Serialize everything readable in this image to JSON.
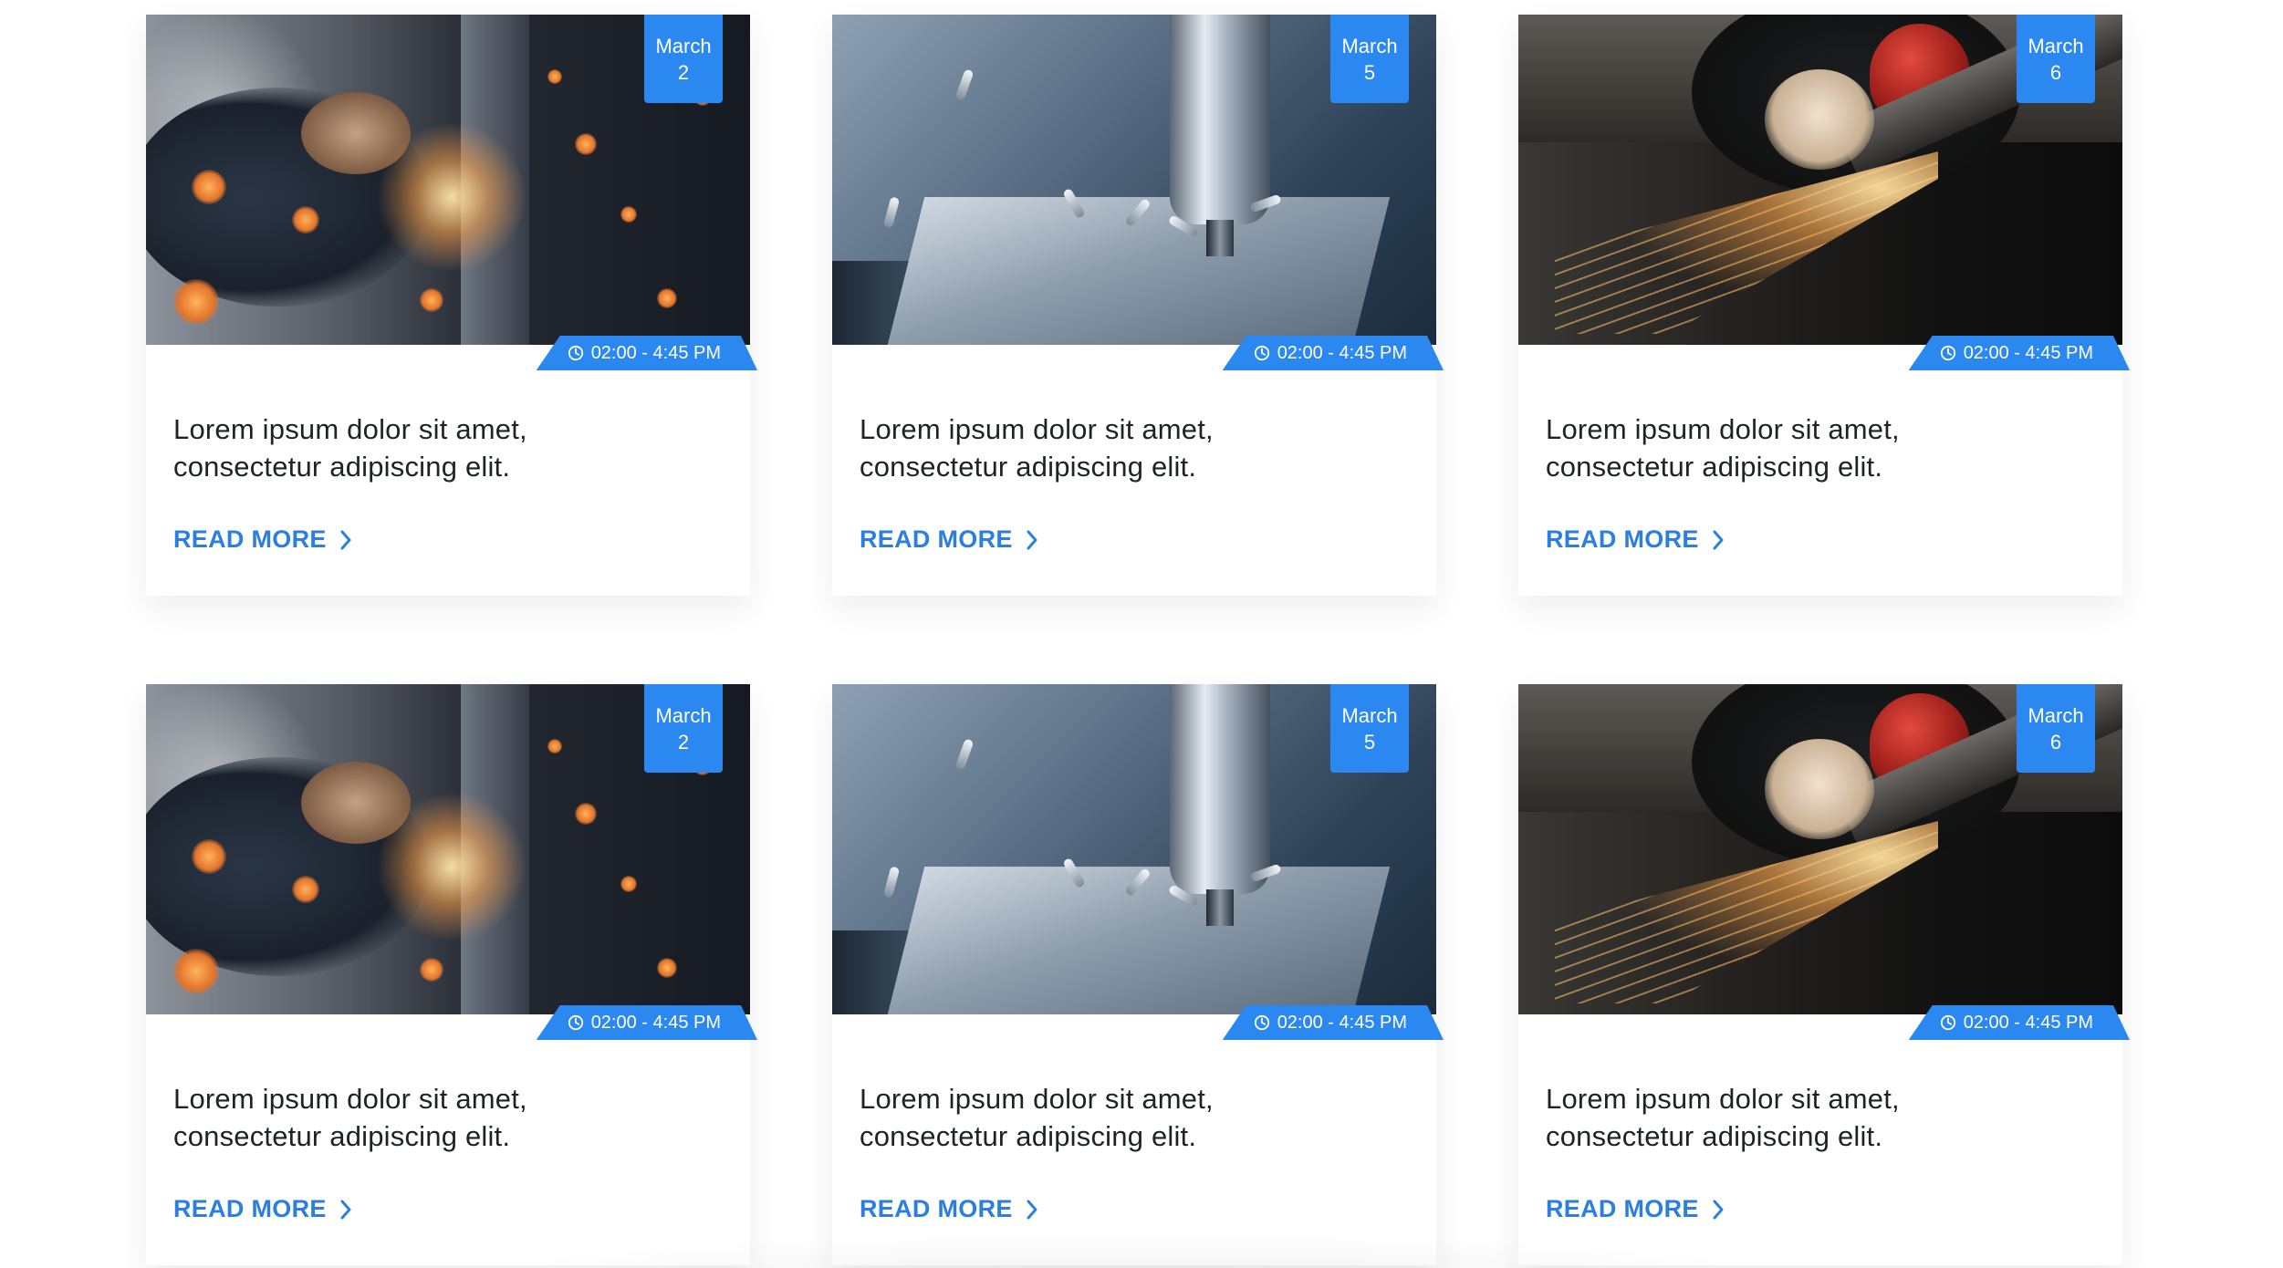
{
  "cards": [
    {
      "month": "March",
      "day": "2",
      "time": "02:00 - 4:45 PM",
      "title_line1": "Lorem ipsum dolor sit amet,",
      "title_line2": "consectetur adipiscing elit.",
      "link": "READ MORE"
    },
    {
      "month": "March",
      "day": "5",
      "time": "02:00 - 4:45 PM",
      "title_line1": "Lorem ipsum dolor sit amet,",
      "title_line2": "consectetur adipiscing elit.",
      "link": "READ MORE"
    },
    {
      "month": "March",
      "day": "6",
      "time": "02:00 - 4:45 PM",
      "title_line1": "Lorem ipsum dolor sit amet,",
      "title_line2": "consectetur adipiscing elit.",
      "link": "READ MORE"
    },
    {
      "month": "March",
      "day": "2",
      "time": "02:00 - 4:45 PM",
      "title_line1": "Lorem ipsum dolor sit amet,",
      "title_line2": "consectetur adipiscing elit.",
      "link": "READ MORE"
    },
    {
      "month": "March",
      "day": "5",
      "time": "02:00 - 4:45 PM",
      "title_line1": "Lorem ipsum dolor sit amet,",
      "title_line2": "consectetur adipiscing elit.",
      "link": "READ MORE"
    },
    {
      "month": "March",
      "day": "6",
      "time": "02:00 - 4:45 PM",
      "title_line1": "Lorem ipsum dolor sit amet,",
      "title_line2": "consectetur adipiscing elit.",
      "link": "READ MORE"
    }
  ],
  "icons": {
    "time": "clock-icon",
    "link": "chevron-right-icon"
  },
  "colors": {
    "accent": "#2b88f0",
    "link": "#2b7fe0",
    "text": "#1f2226"
  }
}
